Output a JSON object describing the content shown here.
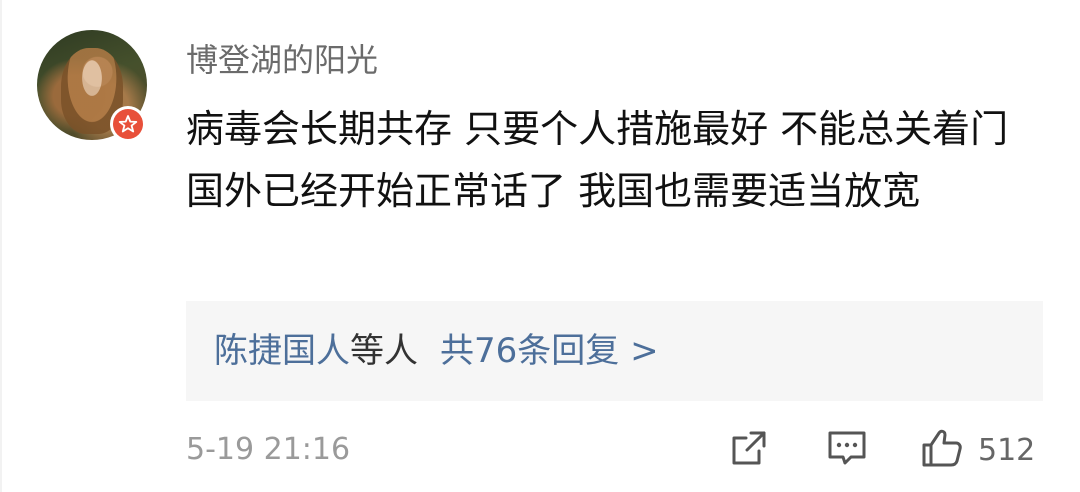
{
  "comment": {
    "username": "博登湖的阳光",
    "text": "病毒会长期共存 只要个人措施最好 不能总关着门 国外已经开始正常话了 我国也需要适当放宽",
    "avatar_icon": "avatar-portrait",
    "badge_icon": "star-badge-icon",
    "badge_color": "#e8503a"
  },
  "replies": {
    "names": "陈捷国人",
    "suffix": "等人",
    "count_text": "共76条回复 >"
  },
  "footer": {
    "timestamp": "5-19 21:16",
    "share_icon": "share-icon",
    "comment_icon": "comment-icon",
    "like_icon": "thumbs-up-icon",
    "like_count": "512"
  },
  "colors": {
    "link": "#4d6f9a",
    "muted": "#9a9a9a",
    "text": "#111111",
    "reply_bg": "#f6f6f6"
  }
}
